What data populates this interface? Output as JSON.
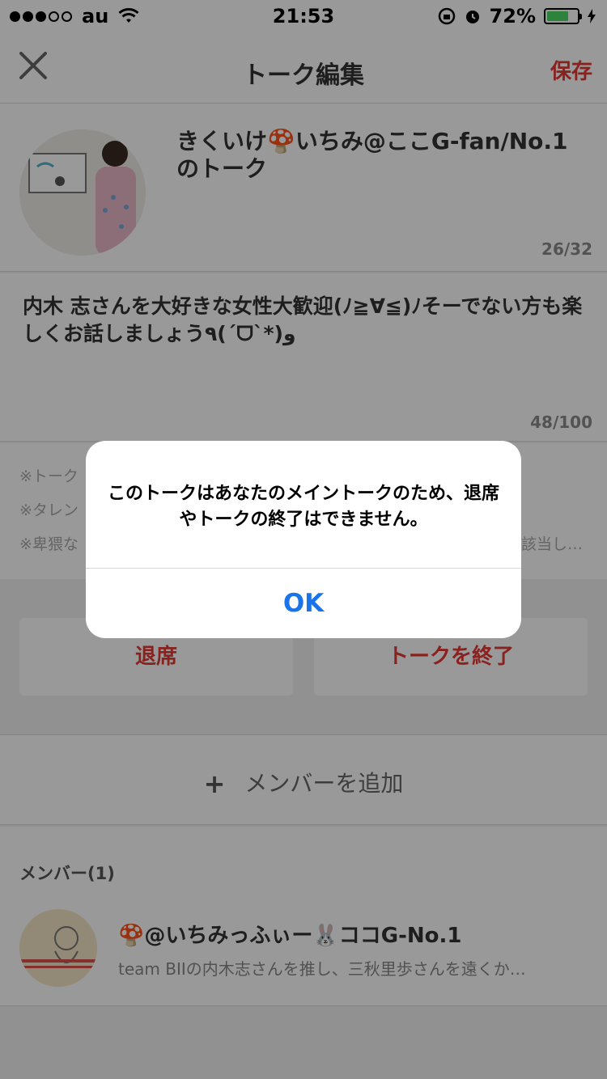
{
  "status_bar": {
    "carrier": "au",
    "time": "21:53",
    "battery": "72%",
    "battery_level": 0.72
  },
  "nav": {
    "title": "トーク編集",
    "save_label": "保存"
  },
  "talk": {
    "name": "きくいけ🍄いちみ@ここG-fan/No.1のトーク",
    "name_counter": "26/32",
    "description": "内木 志さんを大好きな女性大歓迎(ﾉ≧∀≦)ﾉそーでない方も楽しくお話しましょう٩(´ᗜ`*)و",
    "description_counter": "48/100"
  },
  "notes": [
    "※トーク",
    "※タレン",
    "※卑猥な",
    "該当し…"
  ],
  "actions": {
    "leave_label": "退席",
    "end_label": "トークを終了"
  },
  "add_member_label": "メンバーを追加",
  "members": {
    "header": "メンバー(1)",
    "list": [
      {
        "name": "🍄@いちみっふぃー🐰ココG-No.1",
        "description": "team BIIの内木志さんを推し、三秋里歩さんを遠くか…"
      }
    ]
  },
  "dialog": {
    "message": "このトークはあなたのメイントークのため、退席やトークの終了はできません。",
    "ok_label": "OK"
  }
}
